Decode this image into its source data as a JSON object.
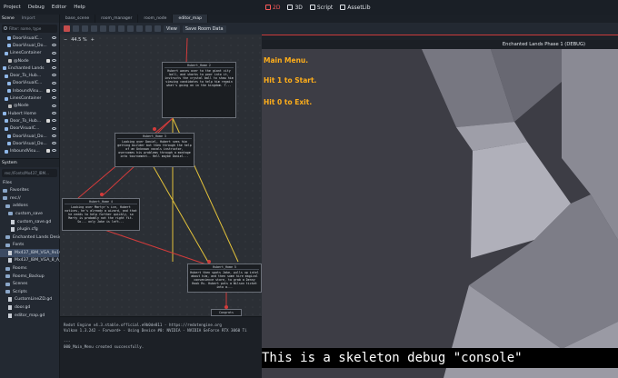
{
  "menu": {
    "items": [
      "Project",
      "Debug",
      "Editor",
      "Help"
    ]
  },
  "main_screens": [
    {
      "label": "2D",
      "active": true
    },
    {
      "label": "3D",
      "active": false
    },
    {
      "label": "Script",
      "active": false
    },
    {
      "label": "AssetLib",
      "active": false
    }
  ],
  "scene_dock": {
    "tab_scene": "Scene",
    "tab_import": "Import",
    "filter_placeholder": "Filter: name, type",
    "nodes": [
      {
        "label": "DoorVisualC...",
        "color": "#8fb7e8"
      },
      {
        "label": "DoorVisual_Do...",
        "color": "#8fb7e8"
      },
      {
        "label": "LinesContainer",
        "color": "#8fb7e8"
      },
      {
        "label": "@Node",
        "color": "#bbbbbb"
      },
      {
        "label": "Enchanted Lands",
        "color": "#8fb7e8"
      },
      {
        "label": "Door_To_Hub...",
        "color": "#8fb7e8"
      },
      {
        "label": "DoorVisualC...",
        "color": "#8fb7e8"
      },
      {
        "label": "InboundVisu...",
        "color": "#8fb7e8"
      },
      {
        "label": "LinesContainer",
        "color": "#8fb7e8"
      },
      {
        "label": "@Node",
        "color": "#bbbbbb"
      },
      {
        "label": "Hubert Home",
        "color": "#8fb7e8"
      },
      {
        "label": "Door_To_Hub...",
        "color": "#8fb7e8"
      },
      {
        "label": "DoorVisualC...",
        "color": "#8fb7e8"
      },
      {
        "label": "DoorVisual_Do...",
        "color": "#8fb7e8"
      },
      {
        "label": "DoorVisual_Do...",
        "color": "#8fb7e8"
      },
      {
        "label": "InboundVisu...",
        "color": "#8fb7e8"
      }
    ]
  },
  "filesystem_dock": {
    "tab": "System",
    "path": "res://Fonts/Mx437_IBM...",
    "filter_label": "Files",
    "entries": [
      {
        "label": "Favorites",
        "kind": "folder",
        "selected": false
      },
      {
        "label": "res://",
        "kind": "folder",
        "selected": false
      },
      {
        "label": "addons",
        "kind": "folder",
        "selected": false
      },
      {
        "label": "custom_save",
        "kind": "folder",
        "selected": false
      },
      {
        "label": "custom_save.gd",
        "kind": "file",
        "selected": false
      },
      {
        "label": "plugin.cfg",
        "kind": "file",
        "selected": false
      },
      {
        "label": "Enchanted Lands Desig...",
        "kind": "folder",
        "selected": false
      },
      {
        "label": "Fonts",
        "kind": "folder",
        "selected": false
      },
      {
        "label": "Mx437_IBM_VGA_9x16...",
        "kind": "file",
        "selected": true
      },
      {
        "label": "Mx437_IBM_VGA_8_A_7...",
        "kind": "file",
        "selected": false
      },
      {
        "label": "Rooms",
        "kind": "folder",
        "selected": false
      },
      {
        "label": "Rooms_Backup",
        "kind": "folder",
        "selected": false
      },
      {
        "label": "Scenes",
        "kind": "folder",
        "selected": false
      },
      {
        "label": "Scripts",
        "kind": "folder",
        "selected": false
      },
      {
        "label": "CustomLineZD.gd",
        "kind": "file",
        "selected": false
      },
      {
        "label": "door.gd",
        "kind": "file",
        "selected": false
      },
      {
        "label": "editor_map.gd",
        "kind": "file",
        "selected": false
      }
    ]
  },
  "scene_tabs": [
    "base_scene",
    "room_manager",
    "room_node",
    "editor_map"
  ],
  "toolbar": {
    "view_label": "View",
    "save_label": "Save Room Data"
  },
  "graph": {
    "zoom": "44.5 %",
    "nodes": [
      {
        "title": "Hubert_Home 2",
        "body": "Hubert waves over to the giant city ball, and sharks to poor into it, instructs the crystal ball to show him viewing candidates to help him regain what's going on in the kingdom. T..."
      },
      {
        "title": "Hubert_Home 3",
        "body": "Looking over Daniel, Hubert sees him getting builder but then through the help of an Unknown vocals instructor, overcomes his problems through a montage into tournament.. Hell maybe Daniel..."
      },
      {
        "title": "Hubert_Home 4",
        "body": "Looking over Martyr's ice, Hubert notices, he's already a wizard, and that he needs to help further quickly, so Marty is probably not the right fit. So... only Jake is left..."
      },
      {
        "title": "Hubert_Home 5",
        "body": "Hubert then spots Jake, pulls up intel about him, and then some hire magical convenience store, to grab a Denny Hook Rs. Hubert puts a Wilson ticket into a..."
      },
      {
        "title": "Congrats",
        "body": ""
      }
    ]
  },
  "output": {
    "lines": [
      "Redot Engine v4.3.stable.official.e9b0de811 - https://redotengine.org",
      "Vulkan 1.3.242 - Forward+ - Using Device #0: NVIDIA - NVIDIA GeForce RTX 3060 Ti",
      "",
      "---",
      "000_Main_Menu created successfully."
    ]
  },
  "game": {
    "window_title": "Enchanted Lands Phase 1 (DEBUG)",
    "hud_lines": [
      "Main Menu.",
      "Hit 1 to Start.",
      "Hit 0 to Exit."
    ],
    "console_text": "This is a skeleton debug \"console\""
  }
}
